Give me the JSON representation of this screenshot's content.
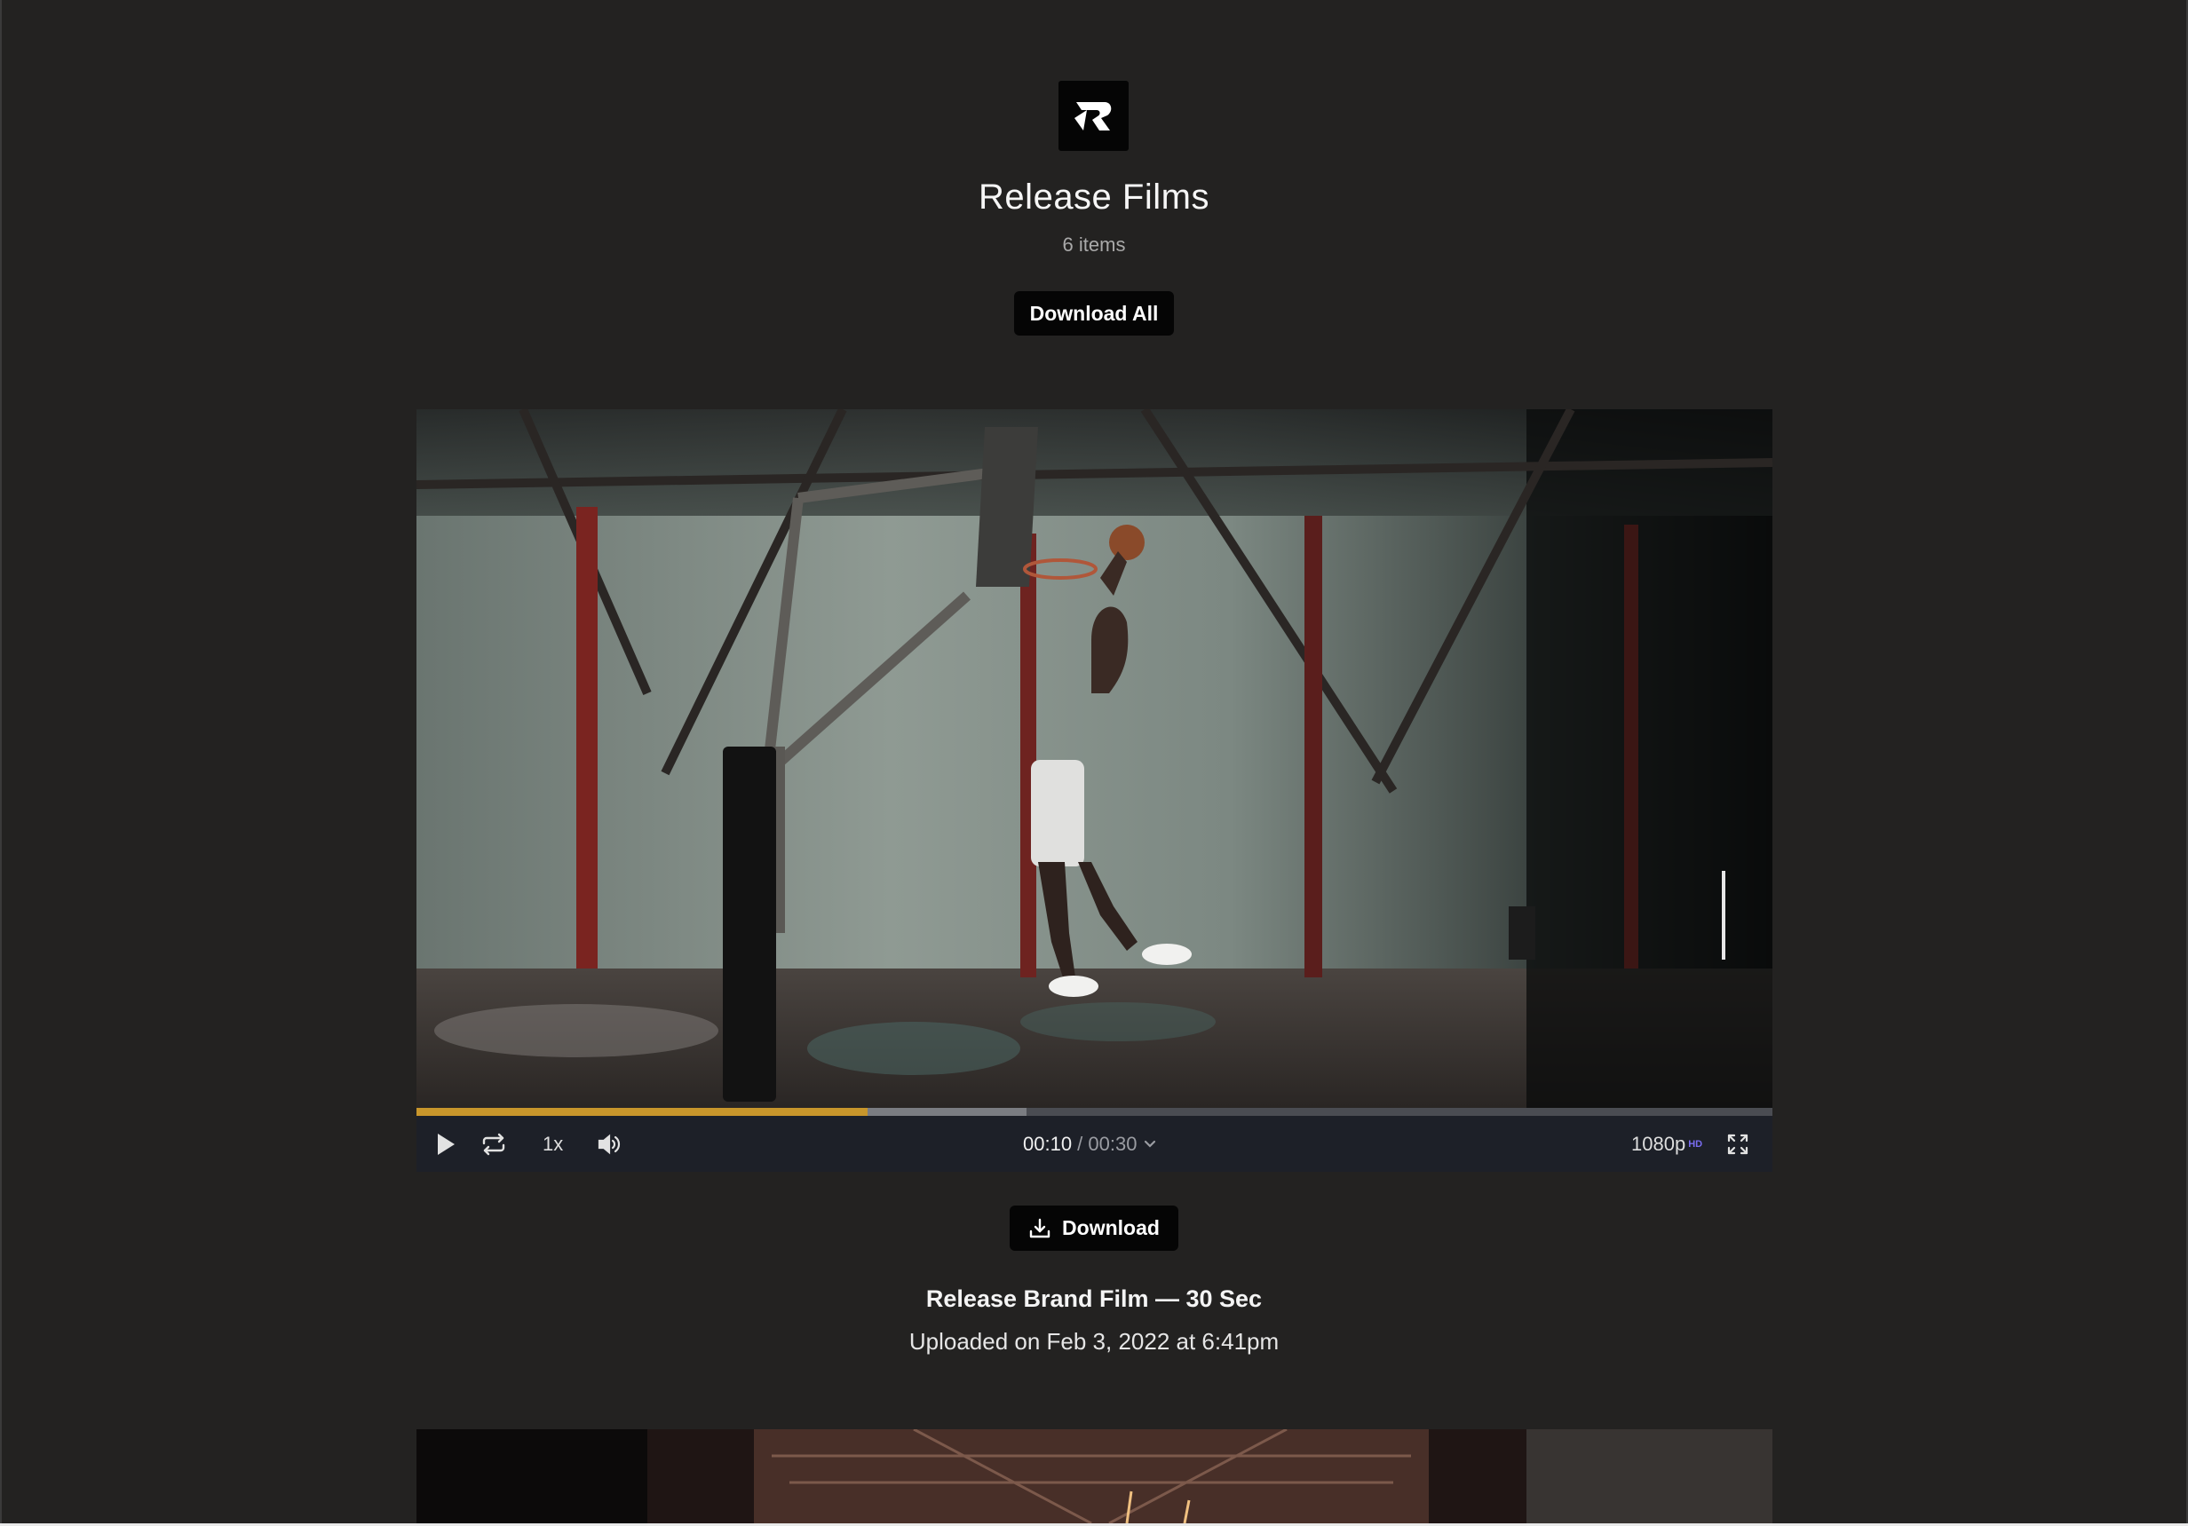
{
  "brand": {
    "logo_letter": "R",
    "icon": "release-logo-icon"
  },
  "collection": {
    "title": "Release Films",
    "item_count": "6 items",
    "download_all_label": "Download All"
  },
  "player": {
    "current_time": "00:10",
    "separator": " / ",
    "duration": "00:30",
    "speed": "1x",
    "quality": "1080p",
    "quality_badge": "HD",
    "progress_played": 0.333,
    "progress_buffered": 0.45,
    "accent_color": "#c8962b",
    "icons": [
      "play-icon",
      "loop-icon",
      "volume-icon",
      "chevron-down-icon",
      "fullscreen-icon"
    ]
  },
  "item": {
    "download_label": "Download",
    "title": "Release Brand Film — 30 Sec",
    "uploaded": "Uploaded on Feb 3, 2022 at 6:41pm"
  }
}
